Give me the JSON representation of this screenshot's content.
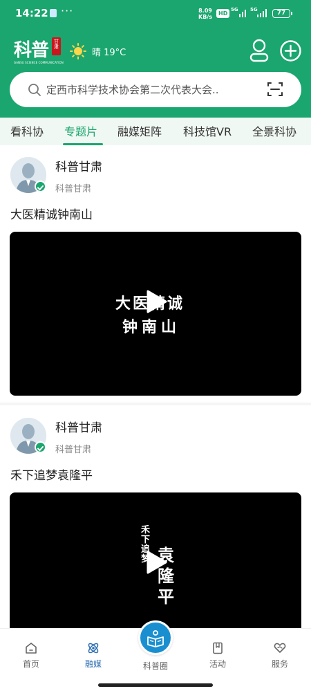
{
  "status_bar": {
    "time": "14:22",
    "more": "···",
    "net_speed_value": "8.09",
    "net_speed_unit": "KB/s",
    "hd_badge": "HD",
    "signal_1": "5G",
    "signal_2": "5G",
    "battery": "77"
  },
  "header": {
    "logo_text": "科普",
    "logo_seal": "甘肃",
    "logo_subtitle": "GANSU SCIENCE COMMUNICATION",
    "weather_icon": "sun-icon",
    "weather": "晴 19°C",
    "user_icon": "user-icon",
    "add_icon": "plus-circle-icon"
  },
  "search": {
    "placeholder": "定西市科学技术协会第二次代表大会..",
    "scan_icon": "scan-icon"
  },
  "tabs": [
    {
      "label": "看科协",
      "active": false
    },
    {
      "label": "专题片",
      "active": true
    },
    {
      "label": "融媒矩阵",
      "active": false
    },
    {
      "label": "科技馆VR",
      "active": false
    },
    {
      "label": "全景科协",
      "active": false
    }
  ],
  "posts": [
    {
      "author": "科普甘肃",
      "author_sub": "科普甘肃",
      "title": "大医精诚钟南山",
      "video_text_line1": "大医精诚",
      "video_text_line2": "钟南山"
    },
    {
      "author": "科普甘肃",
      "author_sub": "科普甘肃",
      "title": "禾下追梦袁隆平",
      "video_text_small": "禾下追梦",
      "video_text_large": "袁隆平"
    }
  ],
  "bottom_nav": [
    {
      "label": "首页",
      "icon": "home-icon",
      "active": false
    },
    {
      "label": "融媒",
      "icon": "atom-icon",
      "active": true
    },
    {
      "label": "科普圈",
      "icon": "book-icon",
      "active": false
    },
    {
      "label": "活动",
      "icon": "bookmark-icon",
      "active": false
    },
    {
      "label": "服务",
      "icon": "heart-hand-icon",
      "active": false
    }
  ],
  "colors": {
    "brand_green": "#1aa66e",
    "active_blue": "#2f6fb3",
    "center_button_blue": "#1a8fd0"
  }
}
